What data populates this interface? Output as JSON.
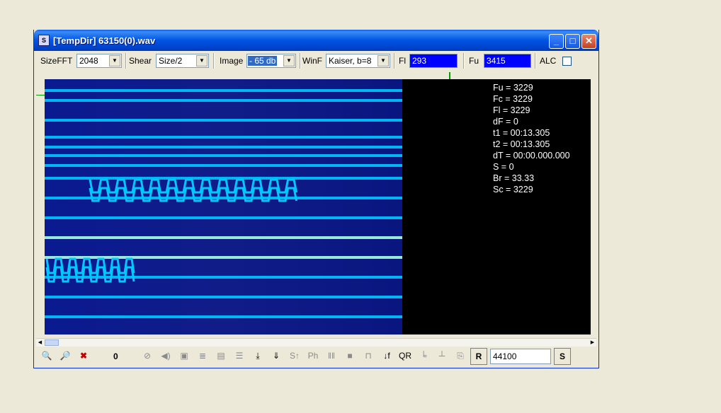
{
  "window": {
    "title": "[TempDir] 63150(0).wav"
  },
  "toolbar": {
    "sizefft_label": "SizeFFT",
    "sizefft_value": "2048",
    "shear_label": "Shear",
    "shear_value": "Size/2",
    "image_label": "Image",
    "image_value": "- 65 db",
    "winf_label": "WinF",
    "winf_value": "Kaiser, b=8",
    "fl_label": "Fl",
    "fl_value": "293",
    "fu_label": "Fu",
    "fu_value": "3415",
    "alc_label": "ALC"
  },
  "readout": [
    "Fu = 3229",
    "Fc = 3229",
    "Fl = 3229",
    "dF = 0",
    "t1 = 00:13.305",
    "t2 = 00:13.305",
    "dT = 00:00.000.000",
    "S = 0",
    "Br = 33.33",
    "Sc = 3229"
  ],
  "bottombar": {
    "counter": "0",
    "ph_label": "Ph",
    "r_label": "R",
    "sample_rate": "44100",
    "s_label": "S"
  },
  "colors": {
    "spectrogram_bg": "#000080",
    "trace": "#00c8ff",
    "strong_trace": "#a8ffe0"
  },
  "icons": [
    "zoom-in-icon",
    "zoom-out-icon",
    "delete-icon",
    "forbidden-icon",
    "speaker-icon",
    "frame-icon",
    "filter-icon",
    "document-icon",
    "waveform-icon",
    "down-arrow-icon",
    "antenna-down-icon"
  ]
}
